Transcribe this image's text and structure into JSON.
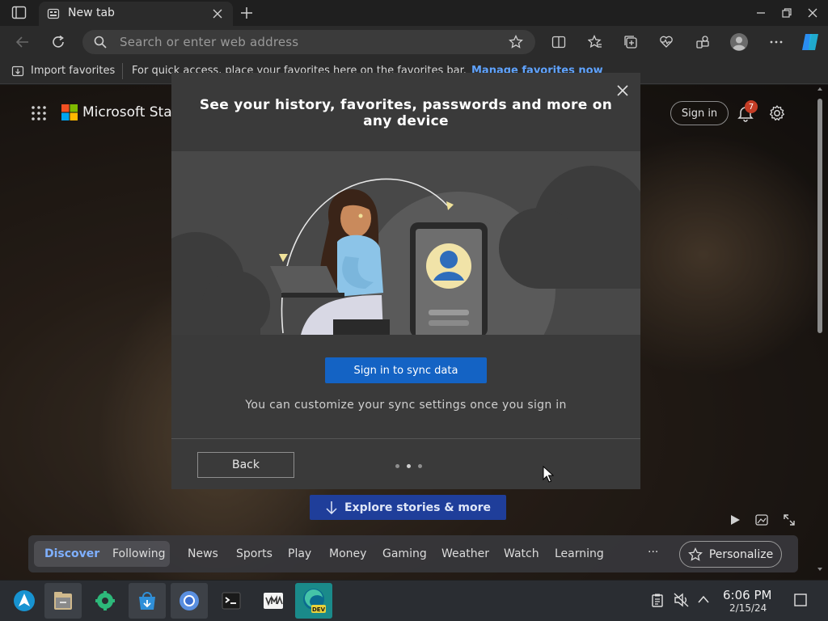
{
  "browser": {
    "tab_title": "New tab",
    "address_placeholder": "Search or enter web address"
  },
  "favorites_bar": {
    "import_label": "Import favorites",
    "hint_text": "For quick access, place your favorites here on the favorites bar.",
    "manage_link": "Manage favorites now"
  },
  "page": {
    "brand": "Microsoft Start",
    "sign_in": "Sign in",
    "notification_count": "7",
    "explore_button": "Explore stories & more",
    "feed_tabs": [
      "Discover",
      "Following"
    ],
    "feed_categories": [
      "News",
      "Sports",
      "Play",
      "Money",
      "Gaming",
      "Weather",
      "Watch",
      "Learning"
    ],
    "more_label": "···",
    "personalize": "Personalize"
  },
  "modal": {
    "title": "See your history, favorites, passwords and more on any device",
    "sync_button": "Sign in to sync data",
    "hint": "You can customize your sync settings once you sign in",
    "back_button": "Back",
    "pager": {
      "total": 3,
      "current": 2
    }
  },
  "taskbar": {
    "time": "6:06 PM",
    "date": "2/15/24",
    "apps": [
      "launcher",
      "files",
      "settings",
      "store",
      "chromium",
      "terminal",
      "vm-manager",
      "edge-dev"
    ]
  },
  "colors": {
    "accent": "#1463c4",
    "explore": "#1f3e9a",
    "badge": "#c43d26"
  }
}
